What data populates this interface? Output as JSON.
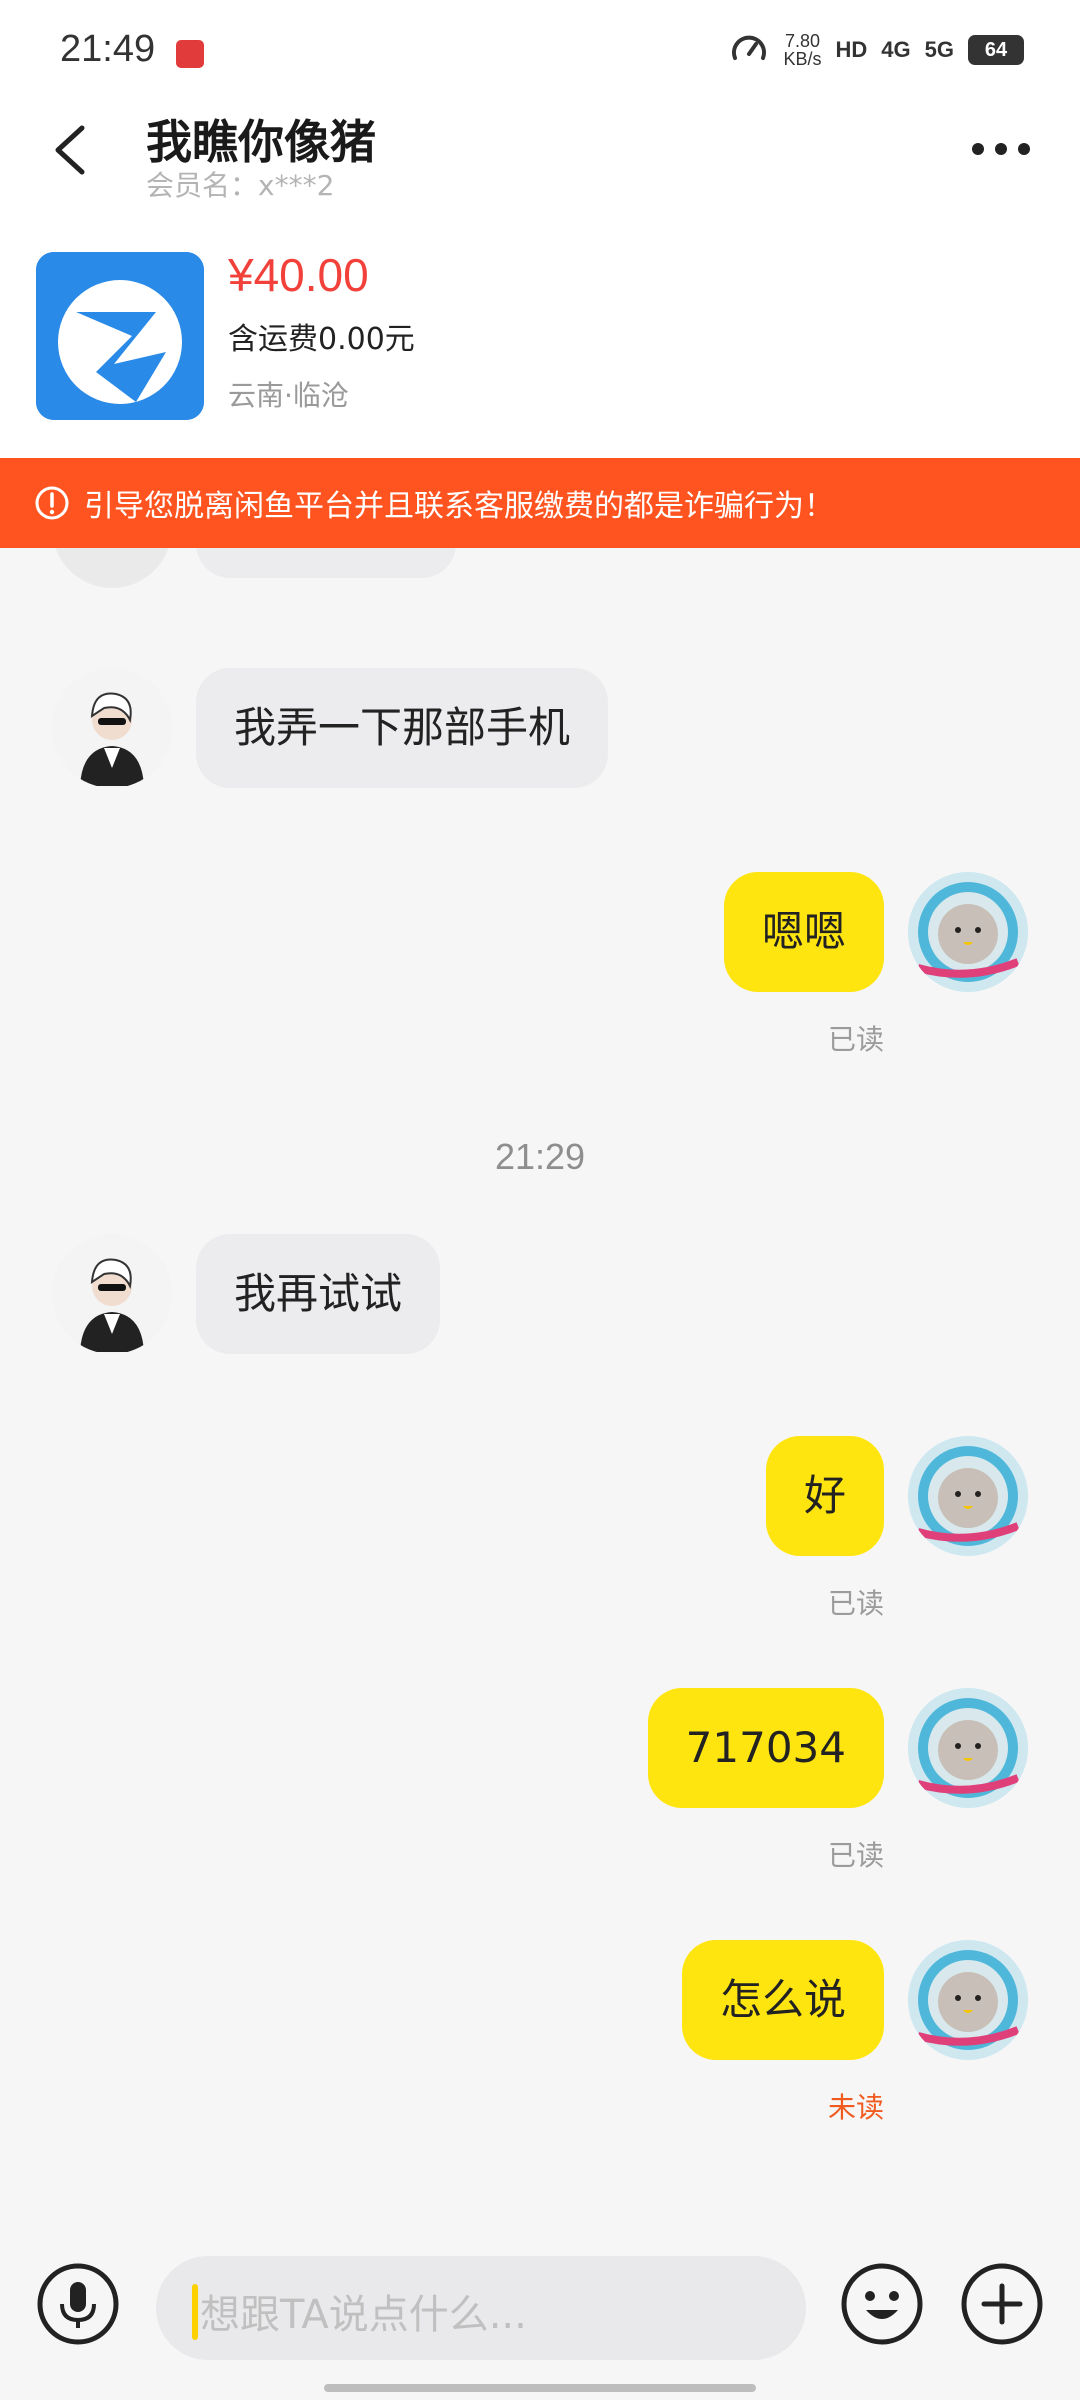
{
  "status_bar": {
    "time": "21:49",
    "speed_value": "7.80",
    "speed_unit": "KB/s",
    "hd_tag": "HD",
    "net_4g": "4G",
    "net_5g": "5G",
    "battery": "64"
  },
  "header": {
    "title": "我瞧你像猪",
    "member_name": "会员名：x***2"
  },
  "product": {
    "price": "¥40.00",
    "shipping": "含运费0.00元",
    "location": "云南·临沧"
  },
  "warning": {
    "text": "引导您脱离闲鱼平台并且联系客服缴费的都是诈骗行为！"
  },
  "messages": [
    {
      "side": "in",
      "text": "我弄一下那部手机"
    },
    {
      "side": "out",
      "text": "嗯嗯",
      "status": "已读"
    },
    {
      "type": "time",
      "text": "21:29"
    },
    {
      "side": "in",
      "text": "我再试试"
    },
    {
      "side": "out",
      "text": "好",
      "status": "已读"
    },
    {
      "side": "out",
      "text": "717034",
      "status": "已读"
    },
    {
      "side": "out",
      "text": "怎么说",
      "status": "未读"
    }
  ],
  "input": {
    "placeholder": "想跟TA说点什么..."
  },
  "colors": {
    "accent_yellow": "#ffe510",
    "warning_orange": "#ff5420",
    "price_red": "#f1413a",
    "unread_orange": "#f05a1f"
  }
}
